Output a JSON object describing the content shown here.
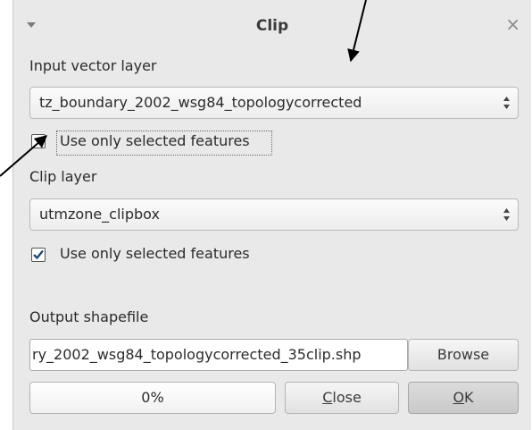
{
  "window": {
    "title": "Clip",
    "close_glyph": "×",
    "menu_icon": "triangle-down-icon"
  },
  "input_layer": {
    "label": "Input vector layer",
    "value": "tz_boundary_2002_wsg84_topologycorrected",
    "use_selected_label": "Use only selected features",
    "use_selected_checked": false
  },
  "clip_layer": {
    "label": "Clip layer",
    "value": "utmzone_clipbox",
    "use_selected_label": "Use only selected features",
    "use_selected_checked": true
  },
  "output": {
    "label": "Output shapefile",
    "value": "ry_2002_wsg84_topologycorrected_35clip.shp",
    "browse_label": "Browse"
  },
  "progress": {
    "value": 0,
    "text": "0%"
  },
  "buttons": {
    "close_accel": "C",
    "close_rest": "lose",
    "ok_accel": "O",
    "ok_rest": "K"
  },
  "colors": {
    "accent": "#2f8fd6",
    "dialog_bg": "#e9e9e9"
  }
}
